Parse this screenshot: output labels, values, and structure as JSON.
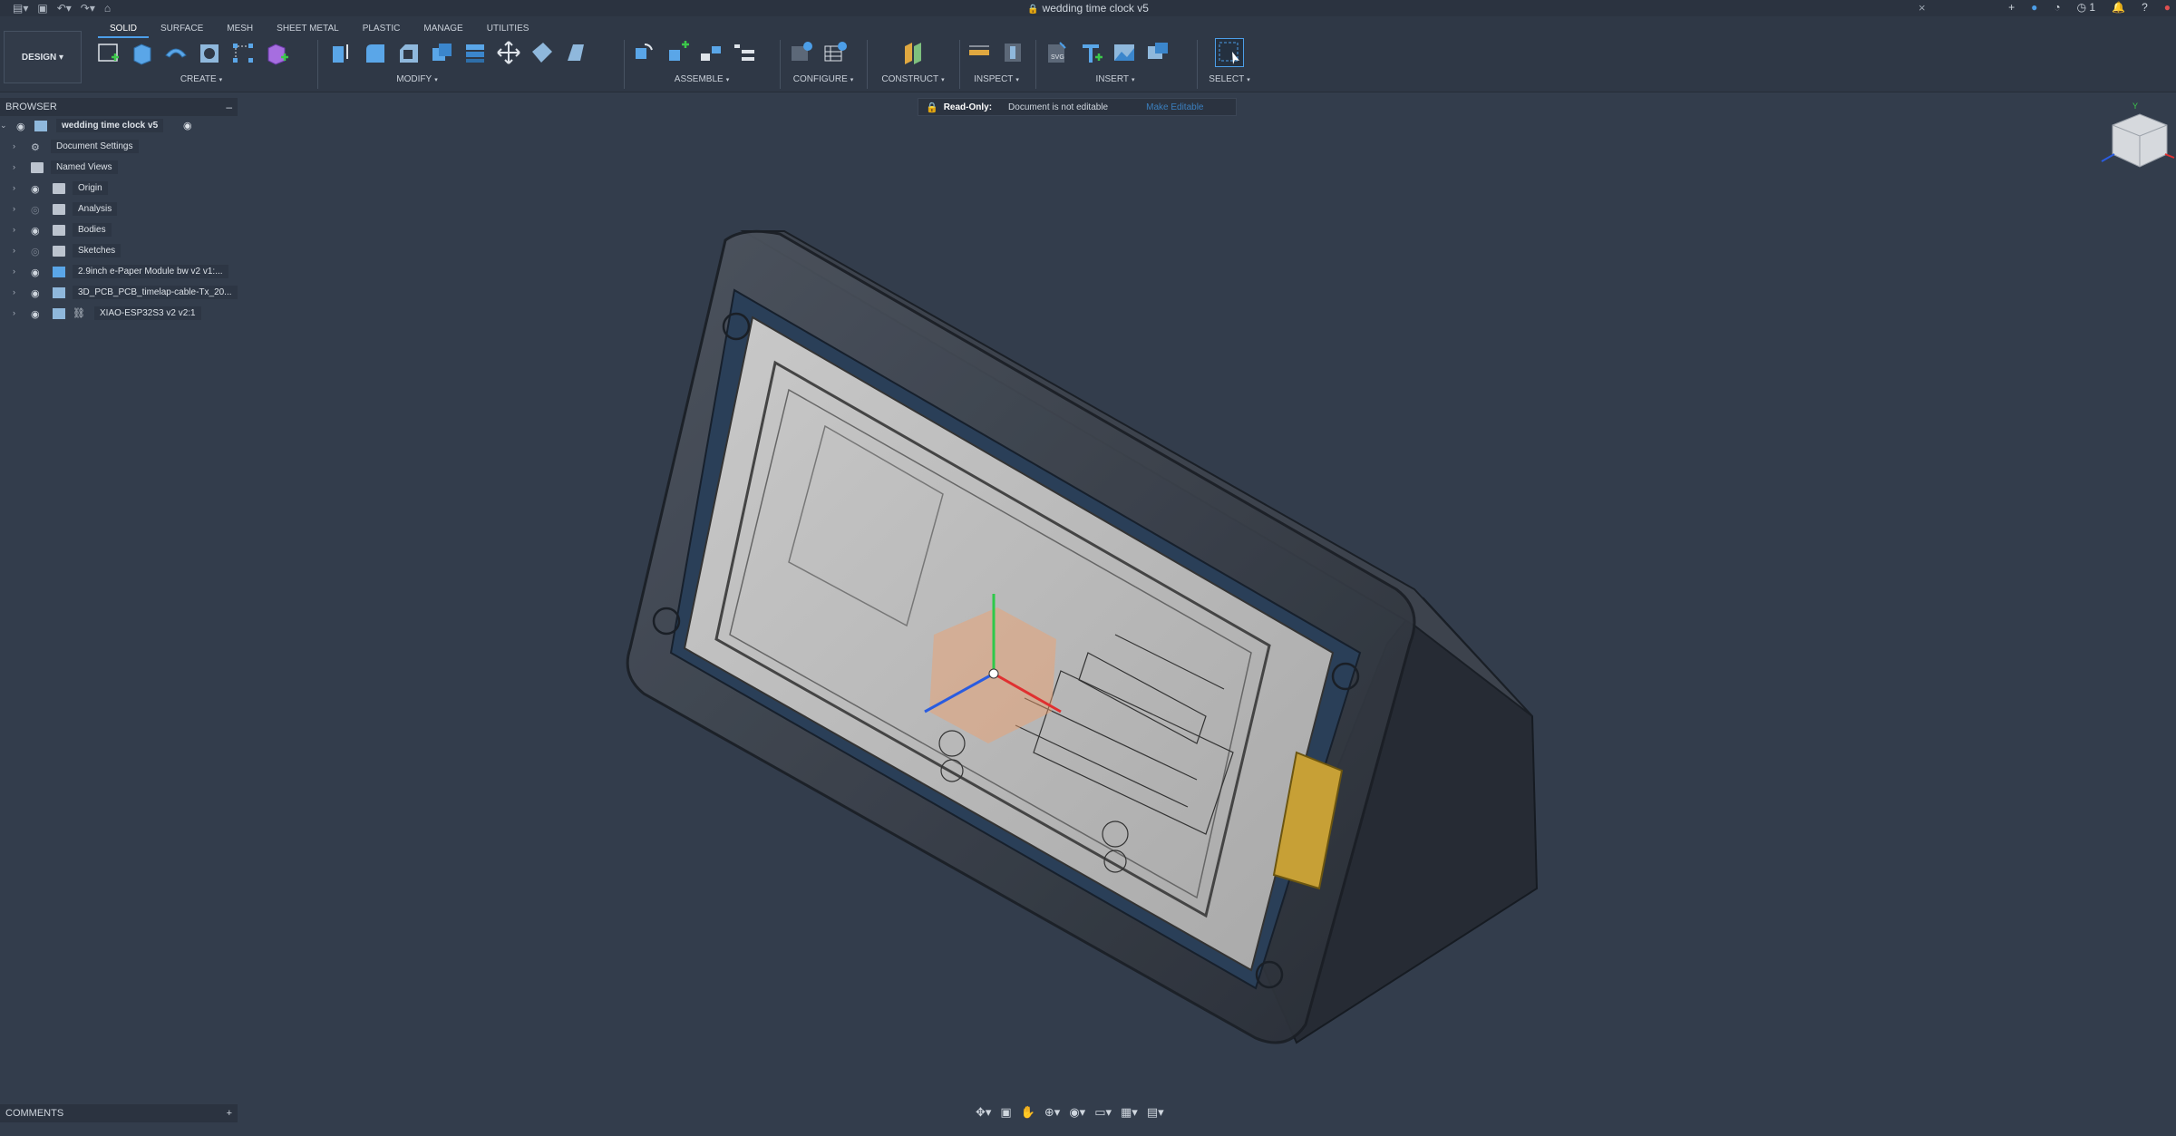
{
  "document": {
    "title": "wedding time clock v5"
  },
  "toolbar": {
    "workspace": "DESIGN",
    "tabs": [
      "SOLID",
      "SURFACE",
      "MESH",
      "SHEET METAL",
      "PLASTIC",
      "MANAGE",
      "UTILITIES"
    ],
    "active_tab": "SOLID",
    "groups": {
      "create": "CREATE",
      "modify": "MODIFY",
      "assemble": "ASSEMBLE",
      "configure": "CONFIGURE",
      "construct": "CONSTRUCT",
      "inspect": "INSPECT",
      "insert": "INSERT",
      "select": "SELECT"
    }
  },
  "title_right": {
    "notifications_count": "1"
  },
  "banner": {
    "label": "Read-Only:",
    "description": "Document is not editable",
    "link": "Make Editable"
  },
  "browser": {
    "title": "BROWSER",
    "root": "wedding time clock v5",
    "items": [
      {
        "label": "Document Settings",
        "icon": "gear-icon"
      },
      {
        "label": "Named Views",
        "icon": "folder-icon"
      },
      {
        "label": "Origin",
        "icon": "folder-icon"
      },
      {
        "label": "Analysis",
        "icon": "folder-icon"
      },
      {
        "label": "Bodies",
        "icon": "folder-icon"
      },
      {
        "label": "Sketches",
        "icon": "folder-icon"
      },
      {
        "label": "2.9inch e-Paper Module bw v2 v1:...",
        "icon": "component-icon"
      },
      {
        "label": "3D_PCB_PCB_timelap-cable-Tx_20...",
        "icon": "assembly-icon"
      },
      {
        "label": "XIAO-ESP32S3 v2 v2:1",
        "icon": "linked-assembly-icon"
      }
    ]
  },
  "comments": {
    "title": "COMMENTS"
  },
  "colors": {
    "accent": "#4c9ee8",
    "background": "#333d4c",
    "panel": "#2b3340",
    "lock": "#f0a030"
  }
}
